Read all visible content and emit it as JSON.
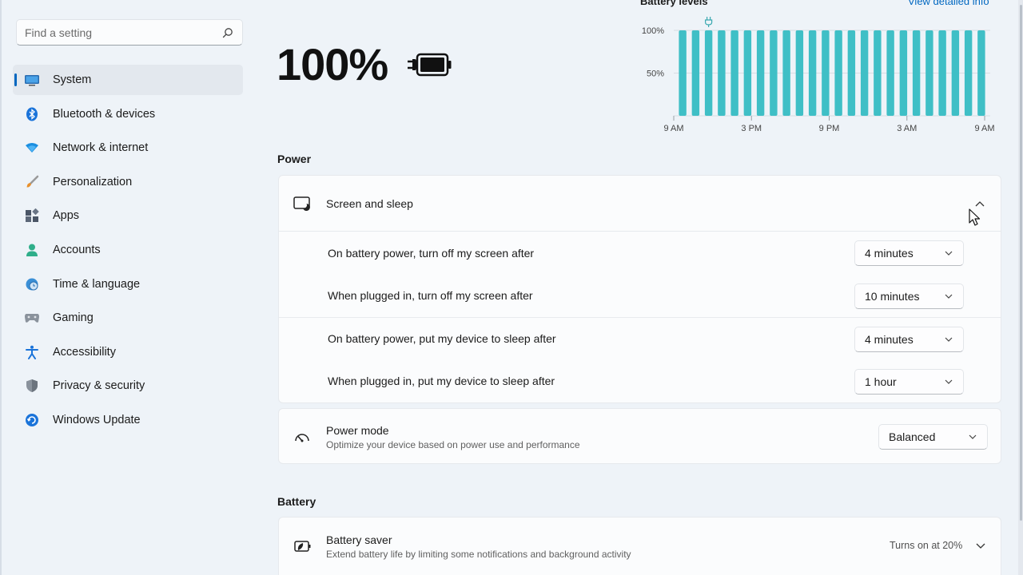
{
  "sidebar": {
    "search_placeholder": "Find a setting",
    "items": [
      {
        "label": "System",
        "icon": "monitor-icon",
        "active": true
      },
      {
        "label": "Bluetooth & devices",
        "icon": "bluetooth-icon"
      },
      {
        "label": "Network & internet",
        "icon": "wifi-icon"
      },
      {
        "label": "Personalization",
        "icon": "brush-icon"
      },
      {
        "label": "Apps",
        "icon": "apps-icon"
      },
      {
        "label": "Accounts",
        "icon": "person-icon"
      },
      {
        "label": "Time & language",
        "icon": "globe-clock-icon"
      },
      {
        "label": "Gaming",
        "icon": "gamepad-icon"
      },
      {
        "label": "Accessibility",
        "icon": "accessibility-icon"
      },
      {
        "label": "Privacy & security",
        "icon": "shield-icon"
      },
      {
        "label": "Windows Update",
        "icon": "update-icon"
      }
    ]
  },
  "battery": {
    "percent": "100%",
    "icon": "battery-charging-icon"
  },
  "chart_data": {
    "type": "bar",
    "title": "Battery levels",
    "link": "View detailed info",
    "y_ticks": [
      "100%",
      "50%"
    ],
    "x_ticks": [
      "9 AM",
      "3 PM",
      "9 PM",
      "3 AM",
      "9 AM"
    ],
    "ylim": [
      0,
      100
    ],
    "values": [
      100,
      100,
      100,
      100,
      100,
      100,
      100,
      100,
      100,
      100,
      100,
      100,
      100,
      100,
      100,
      100,
      100,
      100,
      100,
      100,
      100,
      100,
      100,
      100
    ],
    "plug_marker_index": 2,
    "bar_color": "#3fbfc6"
  },
  "power": {
    "heading": "Power",
    "screen_sleep": {
      "title": "Screen and sleep",
      "icon": "screen-sleep-icon",
      "rows": [
        {
          "label": "On battery power, turn off my screen after",
          "value": "4 minutes"
        },
        {
          "label": "When plugged in, turn off my screen after",
          "value": "10 minutes"
        },
        {
          "label": "On battery power, put my device to sleep after",
          "value": "4 minutes"
        },
        {
          "label": "When plugged in, put my device to sleep after",
          "value": "1 hour"
        }
      ]
    },
    "power_mode": {
      "title": "Power mode",
      "subtitle": "Optimize your device based on power use and performance",
      "value": "Balanced",
      "icon": "speedometer-icon"
    }
  },
  "battery_section": {
    "heading": "Battery",
    "saver": {
      "title": "Battery saver",
      "subtitle": "Extend battery life by limiting some notifications and background activity",
      "status": "Turns on at 20%",
      "icon": "battery-saver-icon"
    }
  },
  "colors": {
    "accent": "#0067c0",
    "bar": "#3fbfc6"
  }
}
